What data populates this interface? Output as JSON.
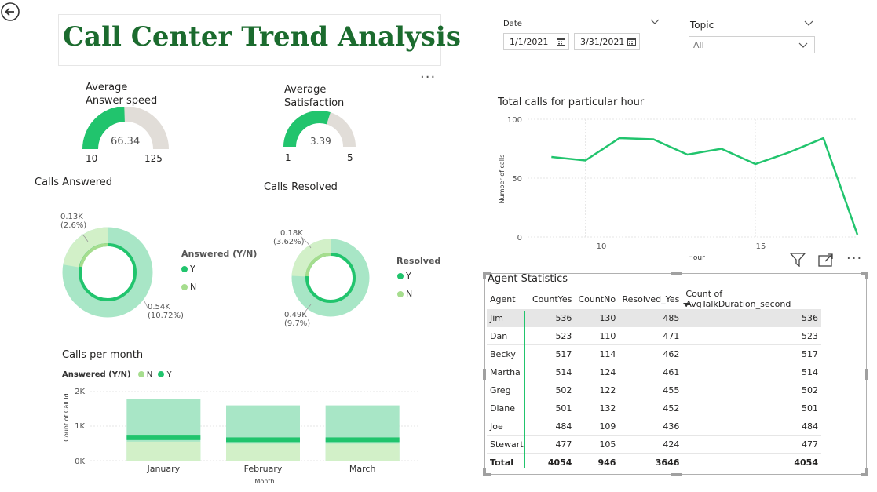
{
  "title": "Call Center Trend Analysis",
  "colors": {
    "green_dark": "#21c46d",
    "green_light": "#a8e6c6",
    "green_pale": "#d2f0c8",
    "gauge_track": "#e1ddd8",
    "title": "#1b6b2e"
  },
  "filters": {
    "date_label": "Date",
    "date_from": "1/1/2021",
    "date_to": "3/31/2021",
    "topic_label": "Topic",
    "topic_value": "All"
  },
  "gauge_speed": {
    "title_line1": "Average",
    "title_line2": "Answer speed",
    "value": 66.34,
    "value_text": "66.34",
    "min": 10,
    "min_text": "10",
    "max": 125,
    "max_text": "125"
  },
  "gauge_satisfaction": {
    "title_line1": "Average",
    "title_line2": "Satisfaction",
    "value": 3.39,
    "value_text": "3.39",
    "min": 1,
    "min_text": "1",
    "max": 5,
    "max_text": "5"
  },
  "calls_answered": {
    "title": "Calls Answered",
    "legend_title": "Answered (Y/N)",
    "legend": [
      {
        "label": "Y",
        "color": "#21c46d"
      },
      {
        "label": "N",
        "color": "#a6dd8e"
      }
    ],
    "label_small_value": "0.13K",
    "label_small_pct": "(2.6%)",
    "label_big_value": "0.54K",
    "label_big_pct": "(10.72%)"
  },
  "calls_resolved": {
    "title": "Calls Resolved",
    "legend_title": "Resolved",
    "legend": [
      {
        "label": "Y",
        "color": "#21c46d"
      },
      {
        "label": "N",
        "color": "#a6dd8e"
      }
    ],
    "label_small_value": "0.18K",
    "label_small_pct": "(3.62%)",
    "label_big_value": "0.49K",
    "label_big_pct": "(9.7%)"
  },
  "calls_per_month": {
    "title": "Calls per month",
    "legend_title": "Answered (Y/N)",
    "legend": [
      {
        "label": "N",
        "color": "#a6dd8e"
      },
      {
        "label": "Y",
        "color": "#21c46d"
      }
    ],
    "yaxis_title": "Count of Call Id",
    "xaxis_title": "Month",
    "yticks": [
      "2K",
      "1K",
      "0K"
    ]
  },
  "total_calls_hour": {
    "title": "Total calls for particular hour",
    "xaxis_title": "Hour",
    "yaxis_title": "Number of calls",
    "yticks": [
      "100",
      "50",
      "0"
    ],
    "xticks": [
      "10",
      "15"
    ]
  },
  "agent_stats": {
    "title": "Agent Statistics",
    "columns": [
      "Agent",
      "CountYes",
      "CountNo",
      "Resolved_Yes",
      "Count of AvgTalkDuration_second"
    ],
    "rows": [
      [
        "Jim",
        "536",
        "130",
        "485",
        "536"
      ],
      [
        "Dan",
        "523",
        "110",
        "471",
        "523"
      ],
      [
        "Becky",
        "517",
        "114",
        "462",
        "517"
      ],
      [
        "Martha",
        "514",
        "124",
        "461",
        "514"
      ],
      [
        "Greg",
        "502",
        "122",
        "455",
        "502"
      ],
      [
        "Diane",
        "501",
        "132",
        "452",
        "501"
      ],
      [
        "Joe",
        "484",
        "109",
        "436",
        "484"
      ],
      [
        "Stewart",
        "477",
        "105",
        "424",
        "477"
      ]
    ],
    "total": [
      "Total",
      "4054",
      "946",
      "3646",
      "4054"
    ]
  },
  "chart_data": [
    {
      "type": "line",
      "title": "Total calls for particular hour",
      "xlabel": "Hour",
      "ylabel": "Number of calls",
      "x": [
        9,
        10,
        11,
        12,
        13,
        14,
        15,
        16,
        17,
        18
      ],
      "values": [
        68,
        65,
        84,
        83,
        70,
        75,
        62,
        72,
        84,
        2
      ],
      "ylim": [
        0,
        100
      ],
      "xlim": [
        8.3,
        18
      ]
    },
    {
      "type": "bar",
      "title": "Calls per month",
      "xlabel": "Month",
      "ylabel": "Count of Call Id",
      "categories": [
        "January",
        "February",
        "March"
      ],
      "series": [
        {
          "name": "N",
          "values": [
            1780,
            1600,
            1600
          ]
        },
        {
          "name": "Y",
          "values": [
            170,
            150,
            150
          ]
        }
      ],
      "ylim": [
        0,
        2000
      ]
    }
  ]
}
